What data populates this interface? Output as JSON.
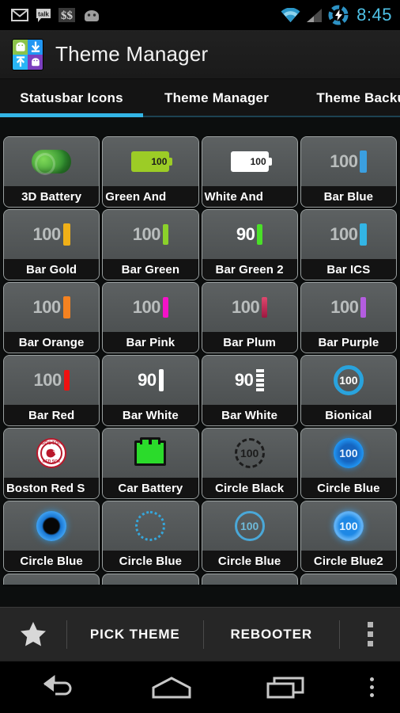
{
  "statusbar": {
    "icons": [
      "gmail-icon",
      "talk-icon",
      "dollars-icon",
      "android-head-icon"
    ],
    "wifi_icon": "wifi-icon",
    "signal_icon": "signal-icon",
    "battery_icon": "battery-charging-icon",
    "time": "8:45",
    "time_color": "#4fc3e8"
  },
  "actionbar": {
    "app_icon": "theme-manager-app-icon",
    "title": "Theme Manager"
  },
  "tabs": {
    "items": [
      {
        "label": "Statusbar Icons",
        "active": true
      },
      {
        "label": "Theme Manager",
        "active": false
      },
      {
        "label": "Theme Backup",
        "active": false
      }
    ],
    "accent_color": "#33b5e5"
  },
  "grid": {
    "items": [
      {
        "label": "3D Battery",
        "icon": "battery-3d-green-icon",
        "truncated": false
      },
      {
        "label": "Green   And",
        "icon": "battery-green-android-icon",
        "truncated": true,
        "value": "100"
      },
      {
        "label": "White   And",
        "icon": "battery-white-android-icon",
        "truncated": true,
        "value": "100"
      },
      {
        "label": "Bar Blue",
        "icon": "bar-blue-icon",
        "truncated": false,
        "value": "100",
        "color": "#3b9fe0"
      },
      {
        "label": "Bar Gold",
        "icon": "bar-gold-icon",
        "truncated": false,
        "value": "100",
        "color": "#f0b018"
      },
      {
        "label": "Bar Green",
        "icon": "bar-green-icon",
        "truncated": false,
        "value": "100",
        "color": "#8bd12a"
      },
      {
        "label": "Bar Green 2",
        "icon": "bar-green2-icon",
        "truncated": false,
        "value": "90",
        "color": "#4ae028"
      },
      {
        "label": "Bar ICS",
        "icon": "bar-ics-icon",
        "truncated": false,
        "value": "100",
        "color": "#33b5e5"
      },
      {
        "label": "Bar Orange",
        "icon": "bar-orange-icon",
        "truncated": false,
        "value": "100",
        "color": "#f58220"
      },
      {
        "label": "Bar Pink",
        "icon": "bar-pink-icon",
        "truncated": false,
        "value": "100",
        "color": "#f412c8"
      },
      {
        "label": "Bar Plum",
        "icon": "bar-plum-icon",
        "truncated": false,
        "value": "100",
        "color": "#c32a5e"
      },
      {
        "label": "Bar Purple",
        "icon": "bar-purple-icon",
        "truncated": false,
        "value": "100",
        "color": "#b45de0"
      },
      {
        "label": "Bar Red",
        "icon": "bar-red-icon",
        "truncated": false,
        "value": "100",
        "color": "#ef1111"
      },
      {
        "label": "Bar White",
        "icon": "bar-white-icon",
        "truncated": false,
        "value": "90",
        "color": "#ffffff"
      },
      {
        "label": "Bar White",
        "icon": "bar-white-dashed-icon",
        "truncated": false,
        "value": "90",
        "color": "#ffffff"
      },
      {
        "label": "Bionical",
        "icon": "circle-bionical-icon",
        "truncated": false,
        "value": "100"
      },
      {
        "label": "Boston Red S",
        "icon": "boston-red-sox-icon",
        "truncated": true
      },
      {
        "label": "Car Battery",
        "icon": "car-battery-icon",
        "truncated": false
      },
      {
        "label": "Circle Black",
        "icon": "circle-black-icon",
        "truncated": false,
        "value": "100"
      },
      {
        "label": "Circle Blue",
        "icon": "circle-blue-glow-icon",
        "truncated": false,
        "value": "100"
      },
      {
        "label": "Circle Blue",
        "icon": "circle-blue-ring-icon",
        "truncated": false
      },
      {
        "label": "Circle Blue",
        "icon": "circle-blue-dotted-icon",
        "truncated": false
      },
      {
        "label": "Circle Blue",
        "icon": "circle-blue-outline-icon",
        "truncated": false,
        "value": "100"
      },
      {
        "label": "Circle Blue2",
        "icon": "circle-blue2-icon",
        "truncated": false,
        "value": "100"
      }
    ]
  },
  "bottombar": {
    "star_icon": "star-icon",
    "pick_theme_label": "PICK THEME",
    "rebooter_label": "REBOOTER",
    "overflow_icon": "overflow-menu-icon"
  },
  "navbar": {
    "back_icon": "back-icon",
    "home_icon": "home-icon",
    "recents_icon": "recents-icon",
    "menu_icon": "menu-overflow-icon"
  }
}
